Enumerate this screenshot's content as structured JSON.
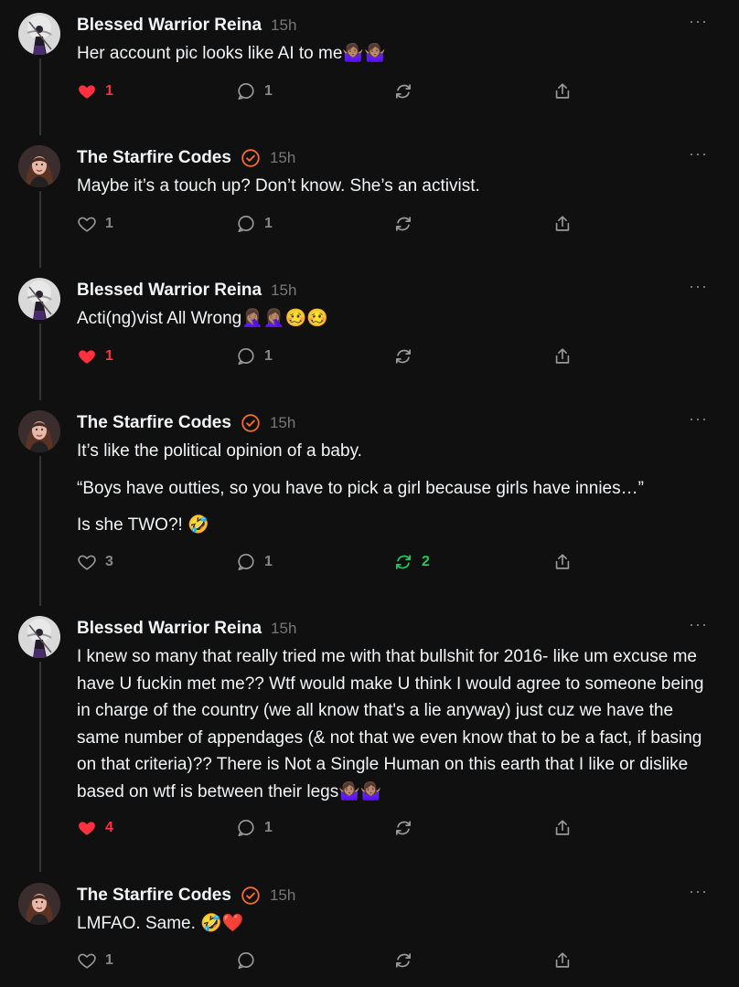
{
  "posts": [
    {
      "author": "Blessed Warrior Reina",
      "verified": false,
      "time": "15h",
      "text": [
        "Her account pic looks like AI to me🤷🏽‍♀️🤷🏽‍♀️"
      ],
      "likes": "1",
      "liked": true,
      "replies": "1",
      "reposts": "",
      "reposted": false
    },
    {
      "author": "The Starfire Codes",
      "verified": true,
      "time": "15h",
      "text": [
        "Maybe it’s a touch up? Don’t know. She’s an activist."
      ],
      "likes": "1",
      "liked": false,
      "replies": "1",
      "reposts": "",
      "reposted": false
    },
    {
      "author": "Blessed Warrior Reina",
      "verified": false,
      "time": "15h",
      "text": [
        "Acti(ng)vist All Wrong🤦🏽‍♀️🤦🏽‍♀️🥴🥴"
      ],
      "likes": "1",
      "liked": true,
      "replies": "1",
      "reposts": "",
      "reposted": false
    },
    {
      "author": "The Starfire Codes",
      "verified": true,
      "time": "15h",
      "text": [
        "It’s like the political opinion of a baby.",
        "“Boys have outties, so you have to pick a girl because girls have innies…”",
        "Is she TWO?! 🤣"
      ],
      "likes": "3",
      "liked": false,
      "replies": "1",
      "reposts": "2",
      "reposted": true
    },
    {
      "author": "Blessed Warrior Reina",
      "verified": false,
      "time": "15h",
      "text": [
        "I knew so many that really tried me with that bullshit for 2016- like um excuse me have U fuckin met me?? Wtf would make U think I would agree to someone being in charge of the country (we all know that's a lie anyway) just cuz we have the same number of appendages (& not that we even know that to be a fact, if basing on that criteria)?? There is Not a Single Human on this earth that I like or dislike based on wtf is between their legs🤷🏽‍♀️🤷🏽‍♀️"
      ],
      "likes": "4",
      "liked": true,
      "replies": "1",
      "reposts": "",
      "reposted": false
    },
    {
      "author": "The Starfire Codes",
      "verified": true,
      "time": "15h",
      "text": [
        "LMFAO. Same. 🤣❤️"
      ],
      "likes": "1",
      "liked": false,
      "replies": "",
      "reposts": "",
      "reposted": false
    }
  ],
  "icons": {
    "like": "heart-icon",
    "reply": "speech-bubble-icon",
    "repost": "repost-arrows-icon",
    "share": "share-upload-icon",
    "more": "more-options-icon",
    "verified": "verified-badge-icon"
  },
  "colors": {
    "background": "#101010",
    "text": "#f3f5f7",
    "muted": "#777777",
    "like": "#ff3040",
    "repost": "#1ec760",
    "verified": "#f56a2b"
  }
}
